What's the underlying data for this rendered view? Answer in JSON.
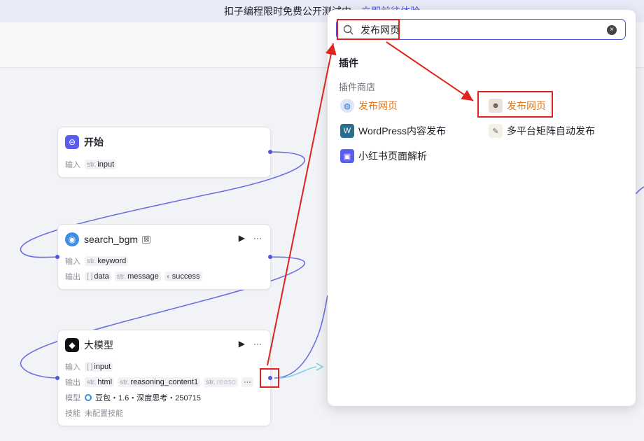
{
  "banner": {
    "text": "扣子编程限时免费公开测试中，",
    "link": "立即前往体验"
  },
  "search": {
    "value": "发布网页",
    "clear_icon": "×"
  },
  "panel": {
    "section_title": "插件",
    "subsection_title": "插件商店",
    "results": [
      {
        "label": "发布网页",
        "icon": "globe-icon"
      },
      {
        "label": "发布网页",
        "icon": "avatar-icon"
      },
      {
        "label": "WordPress内容发布",
        "icon": "wordpress-icon"
      },
      {
        "label": "多平台矩阵自动发布",
        "icon": "duck-icon"
      },
      {
        "label": "小红书页面解析",
        "icon": "box-icon"
      }
    ]
  },
  "nodes": {
    "start": {
      "title": "开始",
      "input_label": "输入",
      "input_type": "str.",
      "input_name": "input"
    },
    "search": {
      "title": "search_bgm",
      "badge": "⊠",
      "run": "▶",
      "more": "···",
      "input_label": "输入",
      "input_type": "str.",
      "input_name": "keyword",
      "output_label": "输出",
      "outputs": [
        {
          "type": "[ ]",
          "name": "data"
        },
        {
          "type": "str.",
          "name": "message"
        },
        {
          "type": "◐",
          "name": "success"
        }
      ]
    },
    "llm": {
      "title": "大模型",
      "run": "▶",
      "more": "···",
      "input_label": "输入",
      "input_type": "[ ]",
      "input_name": "input",
      "output_label": "输出",
      "outputs": [
        {
          "type": "str.",
          "name": "html"
        },
        {
          "type": "str.",
          "name": "reasoning_content1"
        },
        {
          "type": "str.",
          "name": "reaso"
        }
      ],
      "output_more": "···",
      "model_label": "模型",
      "model_value": "豆包・1.6・深度思考・250715",
      "skill_label": "技能",
      "skill_value": "未配置技能"
    }
  },
  "colors": {
    "accent": "#4d53e8",
    "annotation": "#e0231c",
    "highlight": "#e07a1e",
    "wire": "#5156d9"
  }
}
